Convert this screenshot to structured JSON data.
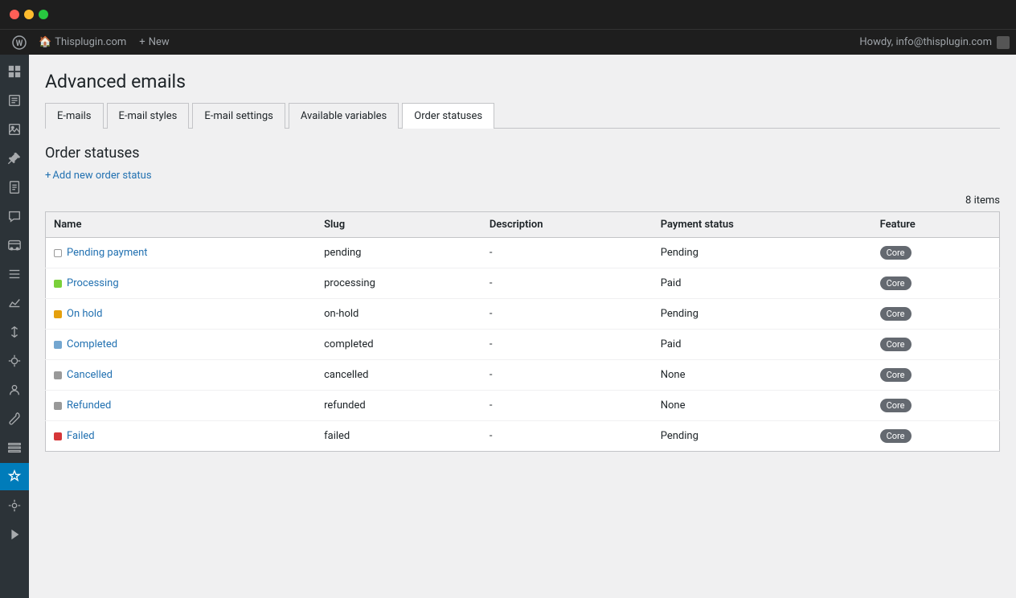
{
  "titlebar": {
    "buttons": [
      "close",
      "minimize",
      "maximize"
    ]
  },
  "adminbar": {
    "wp_icon": "⊞",
    "site_icon": "🏠",
    "site_name": "Thisplugin.com",
    "new_icon": "+",
    "new_label": "New",
    "howdy": "Howdy, info@thisplugin.com"
  },
  "sidebar": {
    "items": [
      {
        "icon": "⊞",
        "name": "dashboard"
      },
      {
        "icon": "✱",
        "name": "posts"
      },
      {
        "icon": "◎",
        "name": "media"
      },
      {
        "icon": "📌",
        "name": "links"
      },
      {
        "icon": "📄",
        "name": "pages"
      },
      {
        "icon": "💬",
        "name": "comments"
      },
      {
        "icon": "⓪",
        "name": "woocommerce"
      },
      {
        "icon": "≡",
        "name": "products"
      },
      {
        "icon": "📊",
        "name": "analytics"
      },
      {
        "icon": "🔔",
        "name": "marketing"
      },
      {
        "icon": "✏",
        "name": "appearance"
      },
      {
        "icon": "👤",
        "name": "users"
      },
      {
        "icon": "⚙",
        "name": "tools"
      },
      {
        "icon": "💻",
        "name": "settings"
      },
      {
        "icon": "🔌",
        "name": "plugins-active"
      },
      {
        "icon": "❋",
        "name": "extra1"
      },
      {
        "icon": "▶",
        "name": "extra2"
      }
    ]
  },
  "page": {
    "title": "Advanced emails",
    "tabs": [
      {
        "label": "E-mails",
        "active": false
      },
      {
        "label": "E-mail styles",
        "active": false
      },
      {
        "label": "E-mail settings",
        "active": false
      },
      {
        "label": "Available variables",
        "active": false
      },
      {
        "label": "Order statuses",
        "active": true
      }
    ],
    "section_title": "Order statuses",
    "add_link_icon": "+",
    "add_link_label": "Add new order status",
    "items_count": "8 items",
    "table": {
      "columns": [
        "Name",
        "Slug",
        "Description",
        "Payment status",
        "Feature"
      ],
      "rows": [
        {
          "dot_class": "dot-white",
          "name": "Pending payment",
          "slug": "pending",
          "description": "-",
          "payment_status": "Pending",
          "payment_color": "normal",
          "feature": "Core"
        },
        {
          "dot_class": "dot-green",
          "name": "Processing",
          "slug": "processing",
          "description": "-",
          "payment_status": "Paid",
          "payment_color": "normal",
          "feature": "Core"
        },
        {
          "dot_class": "dot-yellow",
          "name": "On hold",
          "slug": "on-hold",
          "description": "-",
          "payment_status": "Pending",
          "payment_color": "normal",
          "feature": "Core"
        },
        {
          "dot_class": "dot-blue",
          "name": "Completed",
          "slug": "completed",
          "description": "-",
          "payment_status": "Paid",
          "payment_color": "normal",
          "feature": "Core"
        },
        {
          "dot_class": "dot-gray",
          "name": "Cancelled",
          "slug": "cancelled",
          "description": "-",
          "payment_status": "None",
          "payment_color": "red",
          "feature": "Core"
        },
        {
          "dot_class": "dot-gray",
          "name": "Refunded",
          "slug": "refunded",
          "description": "-",
          "payment_status": "None",
          "payment_color": "red",
          "feature": "Core"
        },
        {
          "dot_class": "dot-red",
          "name": "Failed",
          "slug": "failed",
          "description": "-",
          "payment_status": "Pending",
          "payment_color": "normal",
          "feature": "Core"
        }
      ]
    }
  }
}
